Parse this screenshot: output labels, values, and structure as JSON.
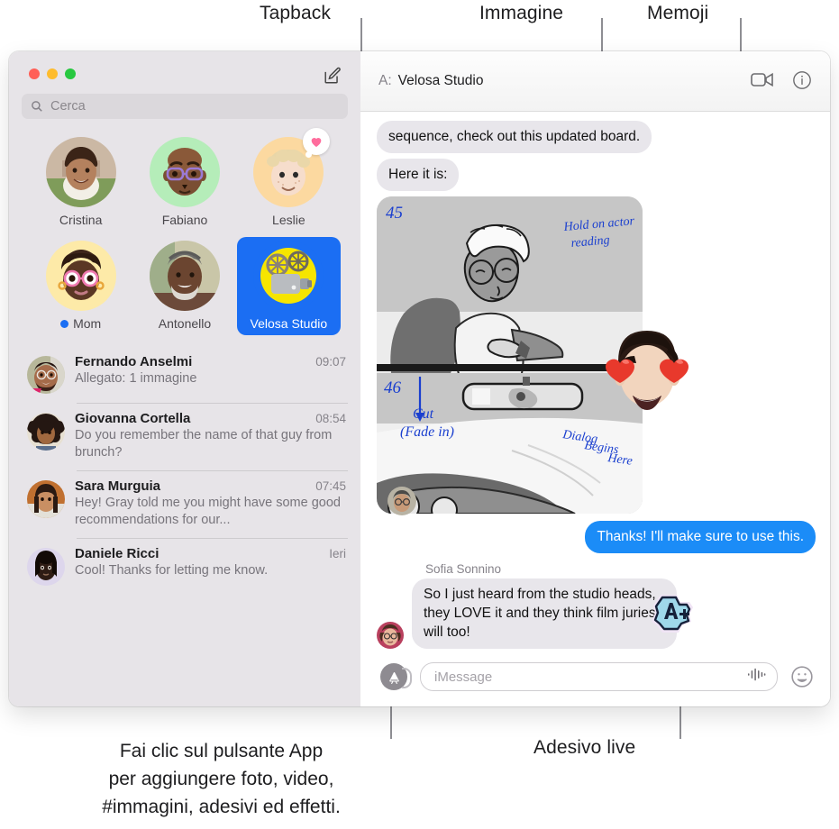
{
  "callouts": {
    "tapback": "Tapback",
    "immagine": "Immagine",
    "memoji": "Memoji",
    "app_button_line1": "Fai clic sul pulsante App",
    "app_button_line2": "per aggiungere foto, video,",
    "app_button_line3": "#immagini, adesivi ed effetti.",
    "live_sticker": "Adesivo live"
  },
  "colors": {
    "accent_blue": "#1b6ef3",
    "bubble_out": "#1b8cf7",
    "bubble_in": "#e8e6eb",
    "sidebar_bg": "#e7e4e8",
    "tapback_heart": "#ff6d9d",
    "traffic_red": "#ff5f57",
    "traffic_yellow": "#febc2e",
    "traffic_green": "#28c840"
  },
  "window": {
    "traffic_lights": [
      "close-button",
      "minimize-button",
      "zoom-button"
    ],
    "compose_icon": "compose-icon"
  },
  "sidebar": {
    "search": {
      "placeholder": "Cerca",
      "icon": "search-icon"
    },
    "pinned": [
      {
        "name": "Cristina",
        "avatar_type": "photo",
        "unread": false,
        "tapback": null,
        "selected": false
      },
      {
        "name": "Fabiano",
        "avatar_type": "memoji",
        "unread": false,
        "tapback": null,
        "selected": false
      },
      {
        "name": "Leslie",
        "avatar_type": "memoji",
        "unread": false,
        "tapback": "heart-tapback",
        "selected": false
      },
      {
        "name": "Mom",
        "avatar_type": "memoji",
        "unread": true,
        "tapback": null,
        "selected": false
      },
      {
        "name": "Antonello",
        "avatar_type": "photo",
        "unread": false,
        "tapback": null,
        "selected": false
      },
      {
        "name": "Velosa Studio",
        "avatar_type": "projector-emoji",
        "unread": false,
        "tapback": null,
        "selected": true
      }
    ],
    "conversations": [
      {
        "name": "Fernando Anselmi",
        "time": "09:07",
        "preview": "Allegato:  1 immagine"
      },
      {
        "name": "Giovanna Cortella",
        "time": "08:54",
        "preview": "Do you remember the name of that guy from brunch?"
      },
      {
        "name": "Sara Murguia",
        "time": "07:45",
        "preview": "Hey! Gray told me you might have some good recommendations for our..."
      },
      {
        "name": "Daniele Ricci",
        "time": "Ieri",
        "preview": "Cool! Thanks for letting me know."
      }
    ]
  },
  "pane": {
    "header": {
      "to_label": "A:",
      "to_value": "Velosa Studio",
      "facetime_icon": "video-camera-icon",
      "info_icon": "info-icon"
    },
    "messages": [
      {
        "kind": "text",
        "side": "in",
        "text": "sequence, check out this updated board."
      },
      {
        "kind": "text",
        "side": "in",
        "text": "Here it is:"
      },
      {
        "kind": "image",
        "side": "in",
        "description": "storyboard-image",
        "annotations": [
          "45",
          "Hold on actor reading",
          "46",
          "Cut (Fade in)",
          "Dialog Begins Here"
        ],
        "memoji_sticker": "heart-eyes-memoji"
      },
      {
        "kind": "text",
        "side": "out",
        "text": "Thanks! I'll make sure to use this."
      },
      {
        "kind": "text",
        "side": "in",
        "sender": "Sofia Sonnino",
        "text": "So I just heard from the studio heads, they LOVE it and they think film juries will too!",
        "sticker": "live-sticker-A"
      }
    ],
    "composer": {
      "app_button": "app-store-button",
      "input_placeholder": "iMessage",
      "audio_icon": "audio-waveform-icon",
      "emoji_icon": "emoji-smiley-icon"
    }
  }
}
